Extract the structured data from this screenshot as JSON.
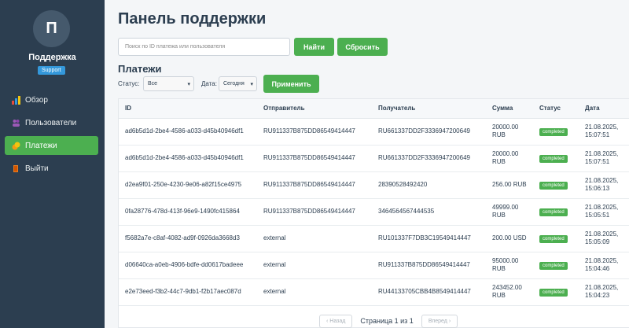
{
  "sidebar": {
    "avatar_letter": "П",
    "name": "Поддержка",
    "role": "Support",
    "items": [
      {
        "label": "Обзор",
        "icon": "chart-icon"
      },
      {
        "label": "Пользователи",
        "icon": "users-icon"
      },
      {
        "label": "Платежи",
        "icon": "payments-icon",
        "active": true
      },
      {
        "label": "Выйти",
        "icon": "logout-icon"
      }
    ]
  },
  "header": {
    "title": "Панель поддержки",
    "search_placeholder": "Поиск по ID платежа или пользователя",
    "find_label": "Найти",
    "reset_label": "Сбросить"
  },
  "payments": {
    "title": "Платежи",
    "status_label": "Статус:",
    "status_value": "Все",
    "date_label": "Дата:",
    "date_value": "Сегодня",
    "apply_label": "Применить",
    "columns": [
      "ID",
      "Отправитель",
      "Получатель",
      "Сумма",
      "Статус",
      "Дата"
    ],
    "rows": [
      {
        "id": "ad6b5d1d-2be4-4586-a033-d45b40946df1",
        "from": "RU911337B875DD86549414447",
        "to": "RU661337DD2F3336947200649",
        "amount": "20000.00 RUB",
        "status": "completed",
        "date": "21.08.2025, 15:07:51"
      },
      {
        "id": "ad6b5d1d-2be4-4586-a033-d45b40946df1",
        "from": "RU911337B875DD86549414447",
        "to": "RU661337DD2F3336947200649",
        "amount": "20000.00 RUB",
        "status": "completed",
        "date": "21.08.2025, 15:07:51"
      },
      {
        "id": "d2ea9f01-250e-4230-9e06-a82f15ce4975",
        "from": "RU911337B875DD86549414447",
        "to": "28390528492420",
        "amount": "256.00 RUB",
        "status": "completed",
        "date": "21.08.2025, 15:06:13"
      },
      {
        "id": "0fa28776-478d-413f-96e9-1490fc415864",
        "from": "RU911337B875DD86549414447",
        "to": "3464564567444535",
        "amount": "49999.00 RUB",
        "status": "completed",
        "date": "21.08.2025, 15:05:51"
      },
      {
        "id": "f5682a7e-c8af-4082-ad9f-0926da3668d3",
        "from": "external",
        "to": "RU101337F7DB3C19549414447",
        "amount": "200.00 USD",
        "status": "completed",
        "date": "21.08.2025, 15:05:09"
      },
      {
        "id": "d06640ca-a0eb-4906-bdfe-dd0617badeee",
        "from": "external",
        "to": "RU911337B875DD86549414447",
        "amount": "95000.00 RUB",
        "status": "completed",
        "date": "21.08.2025, 15:04:46"
      },
      {
        "id": "e2e73eed-f3b2-44c7-9db1-f2b17aec087d",
        "from": "external",
        "to": "RU44133705CBB4B8549414447",
        "amount": "243452.00 RUB",
        "status": "completed",
        "date": "21.08.2025, 15:04:23"
      }
    ]
  },
  "pagination": {
    "prev_label": "Назад",
    "info": "Страница 1 из 1",
    "next_label": "Вперед"
  },
  "colors": {
    "sidebar_bg": "#2c3e50",
    "accent": "#4caf50",
    "badge_blue": "#3498db"
  }
}
